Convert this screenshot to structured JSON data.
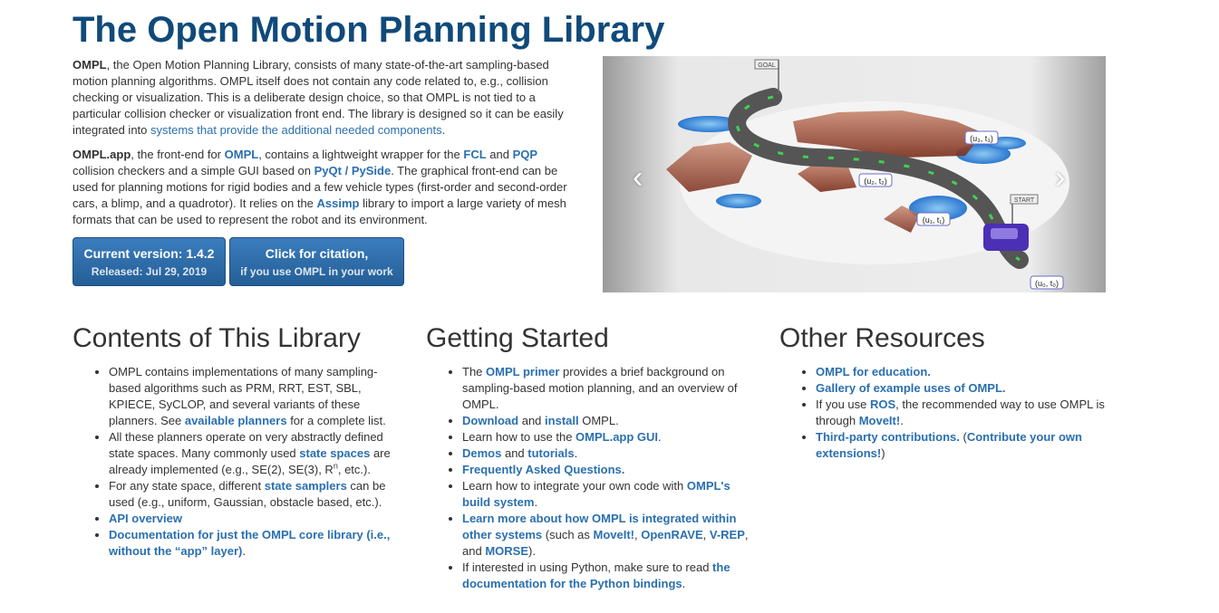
{
  "header": {
    "title": "The Open Motion Planning Library"
  },
  "intro": {
    "p1": {
      "lead": "OMPL",
      "text": ", the Open Motion Planning Library, consists of many state-of-the-art sampling-based motion planning algorithms. OMPL itself does not contain any code related to, e.g., collision checking or visualization. This is a deliberate design choice, so that OMPL is not tied to a particular collision checker or visualization front end. The library is designed so it can be easily integrated into ",
      "link": "systems that provide the additional needed components",
      "end": "."
    },
    "p2": {
      "lead": "OMPL.app",
      "t1": ", the front-end for ",
      "l1": "OMPL",
      "t2": ", contains a lightweight wrapper for the ",
      "l2": "FCL",
      "t3": " and ",
      "l3": "PQP",
      "t4": " collision checkers and a simple GUI based on ",
      "l4": "PyQt / PySide",
      "t5": ". The graphical front-end can be used for planning motions for rigid bodies and a few vehicle types (first-order and second-order cars, a blimp, and a quadrotor). It relies on the ",
      "l5": "Assimp",
      "t6": " library to import a large variety of mesh formats that can be used to represent the robot and its environment."
    }
  },
  "buttons": {
    "version": {
      "title": "Current version: 1.4.2",
      "sub": "Released: Jul 29, 2019"
    },
    "citation": {
      "title": "Click for citation,",
      "sub": "if you use OMPL in your work"
    }
  },
  "carousel": {
    "goal": "GOAL",
    "start": "START",
    "labels": [
      "(u₀, t₀)",
      "(u₁, t₁)",
      "(u₂, t₂)",
      "(u₃, t₃)"
    ],
    "prev": "‹",
    "next": "›"
  },
  "contents": {
    "heading": "Contents of This Library",
    "i1": {
      "t1": "OMPL contains implementations of many sampling-based algorithms such as PRM, RRT, EST, SBL, KPIECE, SyCLOP, and several variants of these planners. See ",
      "l1": "available planners",
      "t2": " for a complete list."
    },
    "i2": {
      "t1": "All these planners operate on very abstractly defined state spaces. Many commonly used ",
      "l1": "state spaces",
      "t2": " are already implemented (e.g., SE(2), SE(3), R",
      "sup": "n",
      "t3": ", etc.)."
    },
    "i3": {
      "t1": "For any state space, different ",
      "l1": "state samplers",
      "t2": " can be used (e.g., uniform, Gaussian, obstacle based, etc.)."
    },
    "i4": {
      "l1": "API overview"
    },
    "i5": {
      "l1": "Documentation for just the OMPL core library (i.e., without the “app” layer)",
      "t1": "."
    }
  },
  "getting_started": {
    "heading": "Getting Started",
    "i1": {
      "t1": "The ",
      "l1": "OMPL primer",
      "t2": " provides a brief background on sampling-based motion planning, and an overview of OMPL."
    },
    "i2": {
      "l1": "Download",
      "t1": " and ",
      "l2": "install",
      "t2": " OMPL."
    },
    "i3": {
      "t1": "Learn how to use the ",
      "l1": "OMPL.app GUI",
      "t2": "."
    },
    "i4": {
      "l1": "Demos",
      "t1": " and ",
      "l2": "tutorials",
      "t2": "."
    },
    "i5": {
      "l1": "Frequently Asked Questions."
    },
    "i6": {
      "t1": "Learn how to integrate your own code with ",
      "l1": "OMPL's build system",
      "t2": "."
    },
    "i7": {
      "l1": "Learn more about how OMPL is integrated within other systems",
      "t1": " (such as ",
      "l2": "MoveIt!",
      "t2": ", ",
      "l3": "OpenRAVE",
      "t3": ", ",
      "l4": "V-REP",
      "t4": ", and ",
      "l5": "MORSE",
      "t5": ")."
    },
    "i8": {
      "t1": "If interested in using Python, make sure to read ",
      "l1": "the documentation for the Python bindings",
      "t2": "."
    }
  },
  "other": {
    "heading": "Other Resources",
    "i1": {
      "l1": "OMPL for education."
    },
    "i2": {
      "l1": "Gallery of example uses of OMPL."
    },
    "i3": {
      "t1": "If you use ",
      "l1": "ROS",
      "t2": ", the recommended way to use OMPL is through ",
      "l2": "MoveIt!",
      "t3": "."
    },
    "i4": {
      "l1": "Third-party contributions.",
      "t1": " (",
      "l2": "Contribute your own extensions!",
      "t2": ")"
    }
  }
}
